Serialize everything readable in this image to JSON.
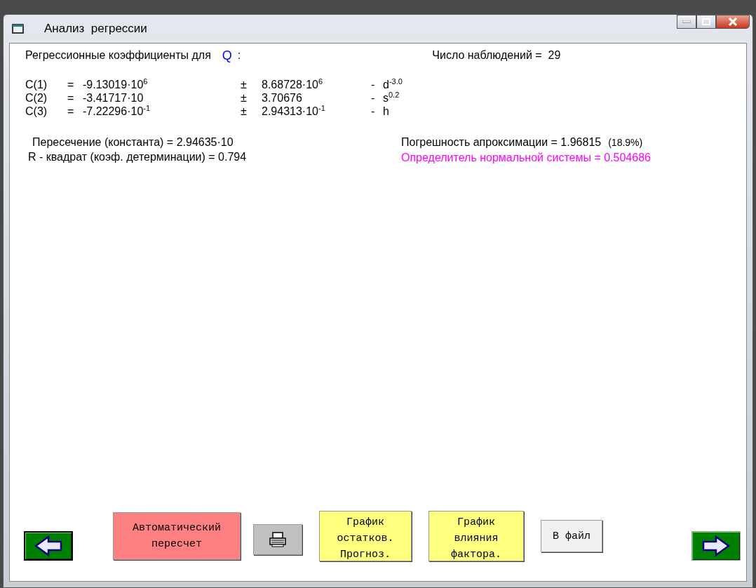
{
  "window": {
    "title": "Анализ  регрессии"
  },
  "header": {
    "label": "Регрессионные коэффициенты для",
    "variable": "Q",
    "colon": ":",
    "observations": "Число наблюдений =  29"
  },
  "coefficients": [
    {
      "name": "C(1)",
      "eq": "=",
      "value": "-9.13019·10$^{6}$",
      "pm": "±",
      "error": "8.68728·10$^{6}$",
      "dash": "-",
      "factor": "d$^{-3.0}$"
    },
    {
      "name": "C(2)",
      "eq": "=",
      "value": "-3.41717·10",
      "pm": "±",
      "error": "3.70676",
      "dash": "-",
      "factor": "s$^{0.2}$"
    },
    {
      "name": "C(3)",
      "eq": "=",
      "value": "-7.22296·10$^{-1}$",
      "pm": "±",
      "error": "2.94313·10$^{-1}$",
      "dash": "-",
      "factor": "h"
    }
  ],
  "intercept": "Пересечение (константа) = 2.94635·10",
  "r_squared": "R - квадрат (коэф. детерминации) = 0.794",
  "approx_error": {
    "label": "Погрешность апроксимации = 1.96815",
    "percent": "(18.9%)"
  },
  "determinant": "Определитель нормальной системы = 0.504686",
  "buttons": [
    {
      "kind": "back",
      "color": "#008000"
    },
    {
      "kind": "text",
      "label": "Автоматический пересчет",
      "color": "#ff8080"
    },
    {
      "kind": "print",
      "color": "#c0c0c0"
    },
    {
      "kind": "text",
      "label": "График остатков. Прогноз.",
      "color": "#ffff80"
    },
    {
      "kind": "text",
      "label": "График влияния фактора.",
      "color": "#ffff80"
    },
    {
      "kind": "text",
      "label": "В файл",
      "color": "#f0f0f0"
    },
    {
      "kind": "forward",
      "color": "#008000"
    }
  ]
}
